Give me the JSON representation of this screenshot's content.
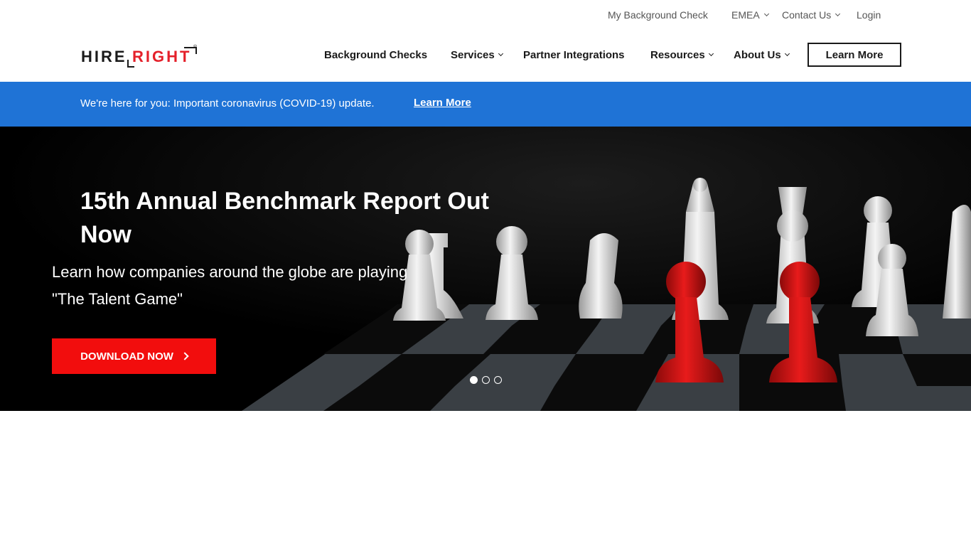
{
  "utility_nav": {
    "my_background_check": "My Background Check",
    "emea": "EMEA",
    "contact_us": "Contact Us",
    "login": "Login"
  },
  "logo": {
    "part1": "HIRE",
    "part2": "RIGHT",
    "mark": "®"
  },
  "main_nav": {
    "background_checks": "Background Checks",
    "services": "Services",
    "partner_integrations": "Partner Integrations",
    "resources": "Resources",
    "about_us": "About Us",
    "learn_more": "Learn More"
  },
  "banner": {
    "message": "We're here for you: Important coronavirus (COVID-19) update.",
    "link": "Learn More",
    "color": "#1f73d6"
  },
  "hero": {
    "title": "15th Annual Benchmark Report Out Now",
    "subtitle": "Learn how companies around the globe are playing \"The Talent Game\"",
    "button": "DOWNLOAD NOW",
    "button_color": "#f20d0d",
    "slides": 3,
    "active_slide": 1
  },
  "colors": {
    "accent_red": "#e4202a",
    "text_dark": "#1a1a1a"
  }
}
